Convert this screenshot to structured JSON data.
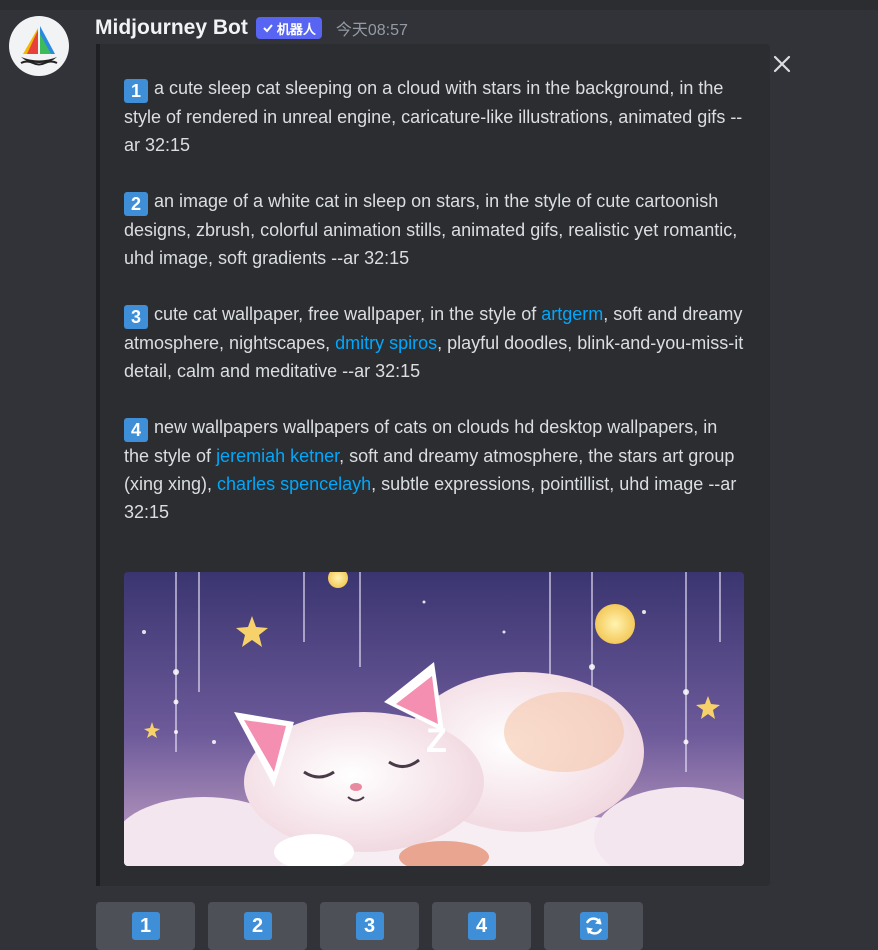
{
  "message": {
    "author": "Midjourney Bot",
    "bot_tag": "机器人",
    "timestamp": "今天08:57"
  },
  "prompts": [
    {
      "number": "1",
      "parts": [
        {
          "text": "a cute sleep cat sleeping on a cloud with stars in the background, in the style of rendered in unreal engine, caricature-like illustrations, animated gifs --ar 32:15",
          "link": false
        }
      ]
    },
    {
      "number": "2",
      "parts": [
        {
          "text": "an image of a white cat in sleep on stars, in the style of cute cartoonish designs, zbrush, colorful animation stills, animated gifs, realistic yet romantic, uhd image, soft gradients --ar 32:15",
          "link": false
        }
      ]
    },
    {
      "number": "3",
      "parts": [
        {
          "text": "cute cat wallpaper, free wallpaper, in the style of ",
          "link": false
        },
        {
          "text": "artgerm",
          "link": true
        },
        {
          "text": ", soft and dreamy atmosphere, nightscapes, ",
          "link": false
        },
        {
          "text": "dmitry spiros",
          "link": true
        },
        {
          "text": ", playful doodles, blink-and-you-miss-it detail, calm and meditative --ar 32:15",
          "link": false
        }
      ]
    },
    {
      "number": "4",
      "parts": [
        {
          "text": "new wallpapers wallpapers of cats on clouds hd desktop wallpapers, in the style of ",
          "link": false
        },
        {
          "text": "jeremiah ketner",
          "link": true
        },
        {
          "text": ", soft and dreamy atmosphere, the stars art group (xing xing), ",
          "link": false
        },
        {
          "text": "charles spencelayh",
          "link": true
        },
        {
          "text": ", subtle expressions, pointillist, uhd image --ar 32:15",
          "link": false
        }
      ]
    }
  ],
  "buttons": [
    {
      "label": "1",
      "name": "select-image-1-button"
    },
    {
      "label": "2",
      "name": "select-image-2-button"
    },
    {
      "label": "3",
      "name": "select-image-3-button"
    },
    {
      "label": "4",
      "name": "select-image-4-button"
    }
  ],
  "colors": {
    "background": "#313338",
    "embed": "#2b2d31",
    "link": "#00a8fc",
    "badge": "#3f8fd8",
    "bot_tag": "#5865f2",
    "button": "#4e5058"
  }
}
